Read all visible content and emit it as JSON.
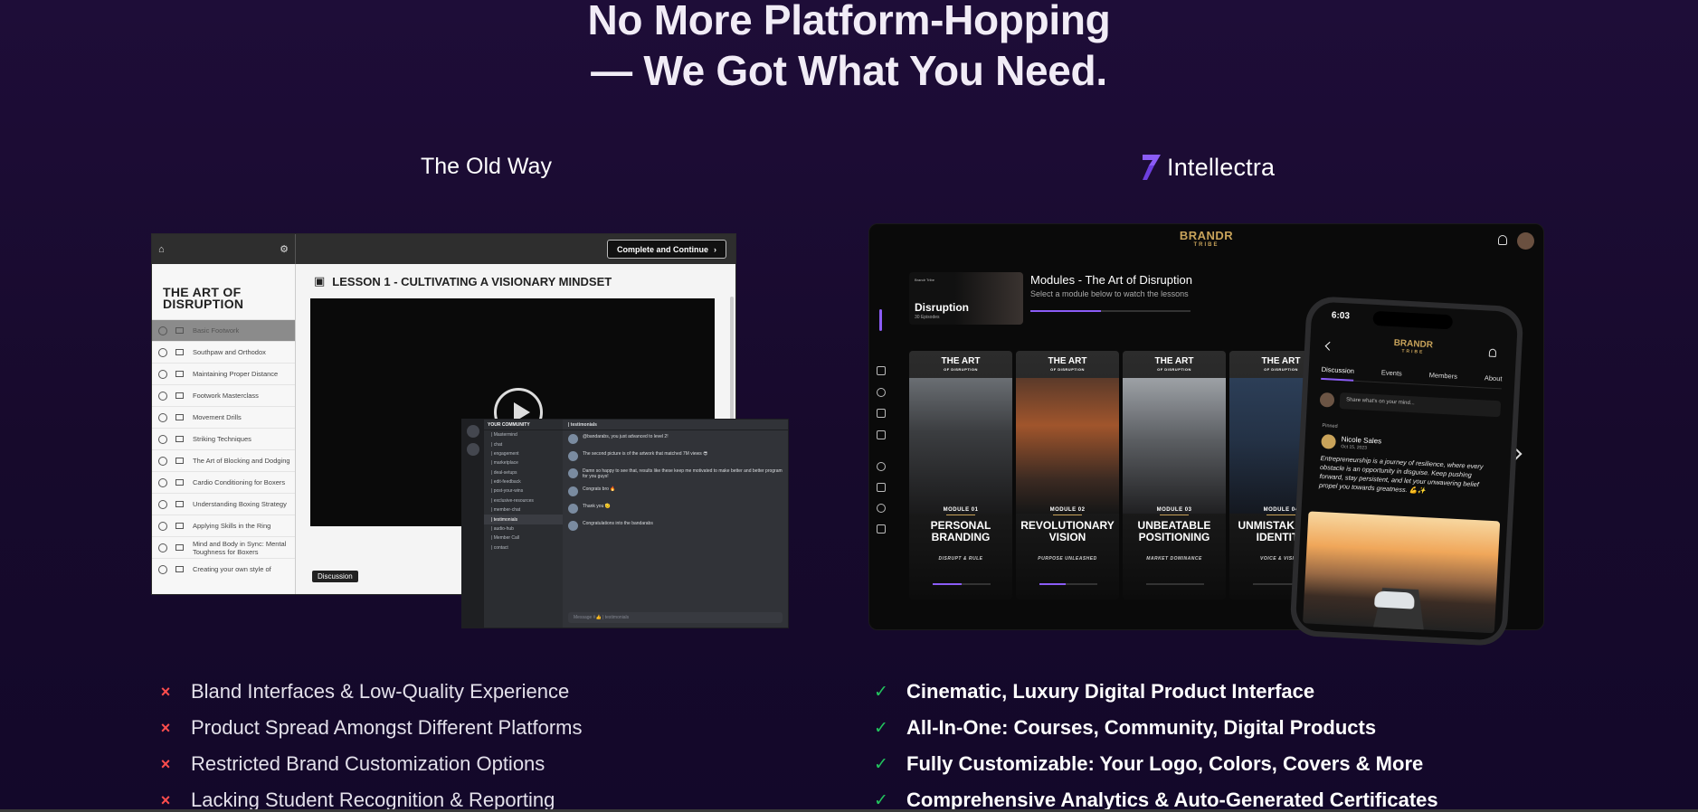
{
  "headline": {
    "line1": "No More Platform-Hopping",
    "line2": "— We Got What You Need."
  },
  "columns": {
    "old": {
      "title": "The Old Way"
    },
    "new": {
      "brand": "Intellectra",
      "logo_icon": "intellectra-logo-icon"
    }
  },
  "old_mock": {
    "lms": {
      "top_button": "Complete and Continue",
      "course_title": "THE ART OF DISRUPTION",
      "lesson_title": "LESSON 1 - CULTIVATING A VISIONARY MINDSET",
      "discussion_label": "Discussion",
      "lessons": [
        "Basic Footwork",
        "Southpaw and Orthodox",
        "Maintaining Proper Distance",
        "Footwork Masterclass",
        "Movement Drills",
        "Striking Techniques",
        "The Art of Blocking and Dodging",
        "Cardio Conditioning for Boxers",
        "Understanding Boxing Strategy",
        "Applying Skills in the Ring",
        "Mind and Body in Sync: Mental Toughness for Boxers",
        "Creating your own style of"
      ]
    },
    "discord": {
      "server_name": "YOUR COMMUNITY",
      "channel_header": "| testimonials",
      "search_placeholder": "Search",
      "channels": [
        "| Mastermind",
        "| chat",
        "| engagement",
        "| marketplace",
        "| deal-setups",
        "| edit-feedback",
        "| post-your-wins",
        "| exclusive-resources",
        "| member-chat",
        "| testimonials",
        "| audio-hub",
        "| Member Call",
        "| contact"
      ],
      "messages": [
        "@bandarabs, you just advanced to level 2!",
        "The second picture is of the artwork that matched 7M views 😎",
        "Damn so happy to see that, results like these keep me motivated to make better and better program for you guys!",
        "Congrats bro 🔥",
        "Thank you 🫡",
        "Congratulations into the bandarabs"
      ],
      "input_placeholder": "Message #👍 | testimonials"
    }
  },
  "new_mock": {
    "brand_logo": "BRANDR",
    "brand_sub": "TRIBE",
    "featured": {
      "label": "Brandr Tribe",
      "title": "Disruption",
      "episodes": "30 Episodes"
    },
    "modules_title": "Modules - The Art of Disruption",
    "modules_subtitle": "Select a module below to watch the lessons",
    "card_heading": "THE ART",
    "card_heading_sub": "OF DISRUPTION",
    "cards": [
      {
        "module": "MODULE 01",
        "name": "PERSONAL BRANDING",
        "tag": "DISRUPT & RULE",
        "progress": 0.5
      },
      {
        "module": "MODULE 02",
        "name": "REVOLUTIONARY VISION",
        "tag": "PURPOSE UNLEASHED",
        "progress": 0.45
      },
      {
        "module": "MODULE 03",
        "name": "UNBEATABLE POSITIONING",
        "tag": "MARKET DOMINANCE",
        "progress": 0.0
      },
      {
        "module": "MODULE 04",
        "name": "UNMISTAKABLE IDENTITY",
        "tag": "VOICE & VISION",
        "progress": 0.0
      }
    ],
    "phone": {
      "time": "6:03",
      "tabs": [
        "Discussion",
        "Events",
        "Members",
        "About"
      ],
      "post_placeholder": "Share what's on your mind...",
      "pinned_label": "Pinned",
      "author": "Nicole Sales",
      "date": "Oct 15, 2023",
      "text": "Entrepreneurship is a journey of resilience, where every obstacle is an opportunity in disguise. Keep pushing forward, stay persistent, and let your unwavering belief propel you towards greatness. 💪✨"
    }
  },
  "old_points": [
    "Bland Interfaces & Low-Quality Experience",
    "Product Spread Amongst Different Platforms",
    "Restricted Brand Customization Options",
    "Lacking Student Recognition & Reporting"
  ],
  "new_points": [
    "Cinematic, Luxury Digital Product Interface",
    "All-In-One: Courses, Community, Digital Products",
    "Fully Customizable: Your Logo, Colors, Covers & More",
    "Comprehensive Analytics & Auto-Generated Certificates"
  ],
  "icons": {
    "bad": "×",
    "good": "✓"
  },
  "colors": {
    "accent": "#8b5cf6",
    "bad": "#ff4d4d",
    "good": "#22c55e",
    "gold": "#c8a35a"
  }
}
